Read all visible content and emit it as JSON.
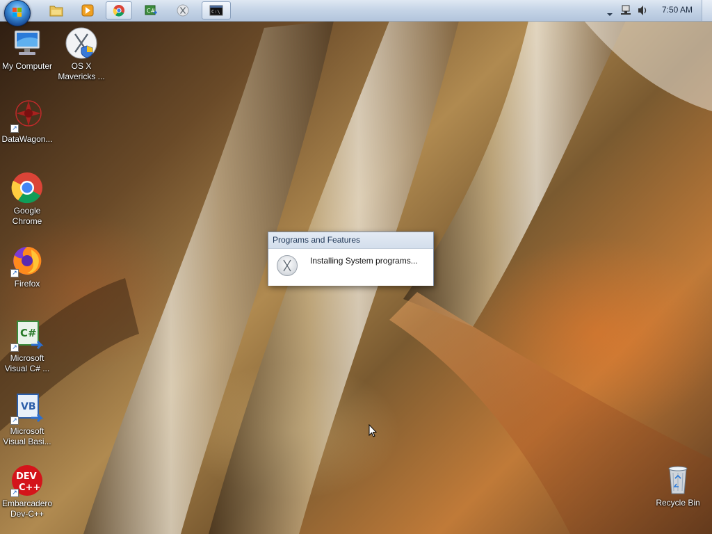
{
  "taskbar": {
    "start_button": "start-orb",
    "pinned": [
      {
        "name": "explorer-taskbar-button",
        "icon": "folder-icon",
        "active": false
      },
      {
        "name": "media-player-taskbar-button",
        "icon": "media-player-icon",
        "active": false
      },
      {
        "name": "chrome-taskbar-button",
        "icon": "chrome-icon",
        "active": true
      },
      {
        "name": "visual-csharp-taskbar-button",
        "icon": "csharp-icon",
        "active": false
      },
      {
        "name": "osx-transformation-taskbar-button",
        "icon": "x-icon",
        "active": false
      },
      {
        "name": "terminal-taskbar-button",
        "icon": "terminal-icon",
        "active": true
      }
    ],
    "tray": {
      "icons": [
        "tray-chevron-icon",
        "network-icon",
        "volume-icon"
      ],
      "clock": "7:50 AM"
    }
  },
  "desktop": {
    "icons": [
      {
        "label": "My Computer",
        "icon": "computer-icon",
        "shortcut": false
      },
      {
        "label": "OS X Mavericks ...",
        "icon": "osx-x-icon",
        "shortcut": false
      },
      {
        "label": "DataWagon...",
        "icon": "datawagon-icon",
        "shortcut": true
      },
      {
        "label": "Google Chrome",
        "icon": "chrome-icon",
        "shortcut": false
      },
      {
        "label": "Firefox",
        "icon": "firefox-icon",
        "shortcut": true
      },
      {
        "label": "Microsoft Visual C# ...",
        "icon": "visual-csharp-icon",
        "shortcut": true
      },
      {
        "label": "Microsoft Visual Basi...",
        "icon": "visual-basic-icon",
        "shortcut": true
      },
      {
        "label": "Embarcadero Dev-C++",
        "icon": "devcpp-icon",
        "shortcut": true
      },
      {
        "label": "Recycle Bin",
        "icon": "recycle-bin-icon",
        "shortcut": false
      }
    ]
  },
  "dialog": {
    "title": "Programs and Features",
    "message": "Installing System programs...",
    "icon": "x-icon"
  },
  "colors": {
    "taskbar": "#c4d3e6",
    "dialog_title_text": "#233a5a",
    "icon_label": "#ffffff"
  }
}
